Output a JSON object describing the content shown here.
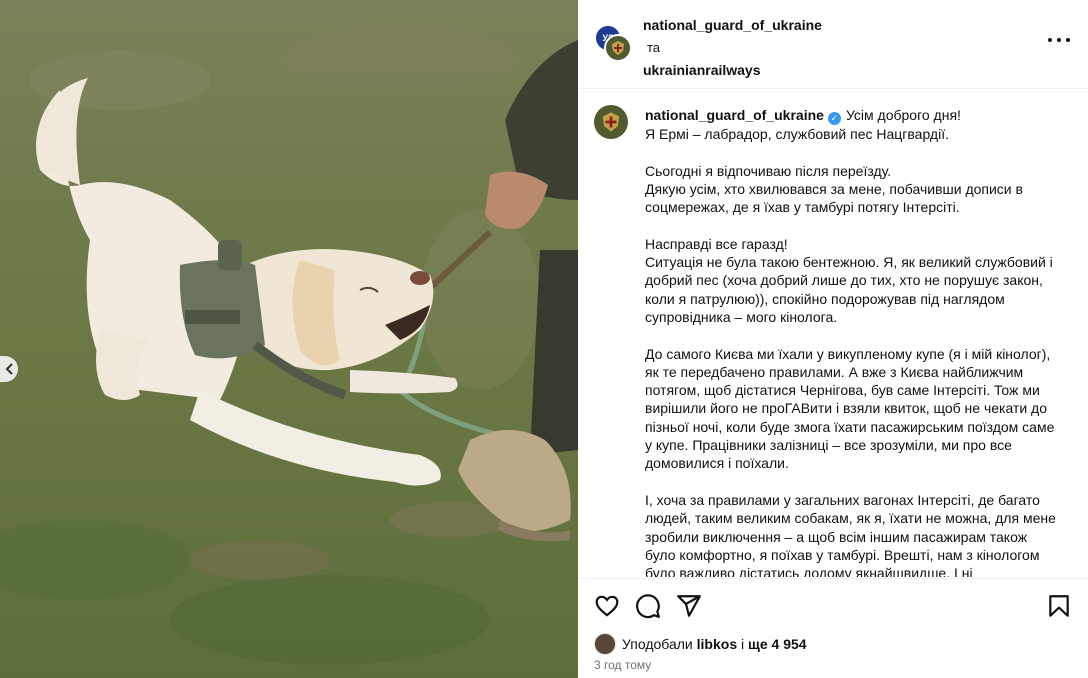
{
  "header": {
    "badge_text": "УЗ",
    "author1": "national_guard_of_ukraine",
    "conjunction": "та",
    "author2": "ukrainianrailways"
  },
  "caption": {
    "username": "national_guard_of_ukraine",
    "lines": [
      "Усім доброго дня!",
      "Я Ермі – лабрадор, службовий пес Нацгвардії.",
      "Сьогодні я відпочиваю після переїзду.",
      "Дякую усім, хто хвилювався за мене, побачивши дописи в соцмережах, де я їхав у тамбурі потягу Інтерсіті.",
      "Насправді все гаразд!",
      "Ситуація не була такою бентежною. Я, як великий службовий і добрий пес (хоча добрий лише до тих, хто не порушує закон, коли я патрулюю)), спокійно подорожував під наглядом супровідника – мого кінолога.",
      "До самого Києва ми їхали у викупленому купе (я і мій кінолог), як те передбачено правилами. А вже з Києва найближчим потягом, щоб дістатися Чернігова, був саме Інтерсіті. Тож ми вирішили його не проГАВити і взяли квиток, щоб не чекати до пізньої ночі, коли буде змога їхати пасажирським поїздом саме у купе. Працівники залізниці – все зрозуміли, ми про все домовилися і поїхали.",
      "І, хоча за правилами у загальних вагонах Інтерсіті, де багато людей, таким великим собакам, як я, їхати не можна, для мене зробили виключення – а щоб всім іншим пасажирам також було комфортно, я поїхав у тамбурі. Врешті, нам з кінологом було важливо дістатись додому якнайшвидше. І ні"
    ]
  },
  "actions": {
    "like_icon": "heart-icon",
    "comment_icon": "comment-icon",
    "share_icon": "share-icon",
    "save_icon": "bookmark-icon"
  },
  "likes": {
    "prefix": "Уподобали",
    "user": "libkos",
    "middle": "і",
    "count": "ще 4 954"
  },
  "timestamp": "3 год тому",
  "colors": {
    "verified": "#3897f0",
    "text": "#111111",
    "muted": "#737373"
  }
}
